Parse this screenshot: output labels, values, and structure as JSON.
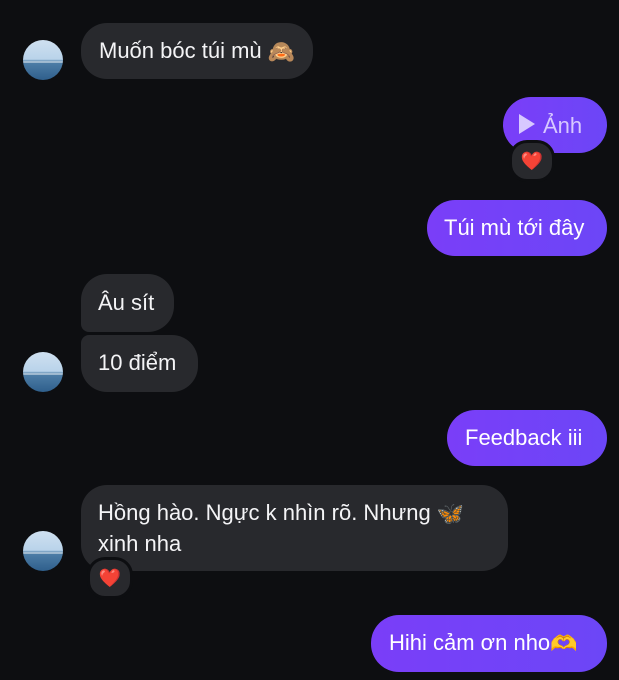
{
  "messages": {
    "m1": {
      "text": "Muốn bóc túi mù",
      "emoji": "🙈"
    },
    "m2": {
      "label": "Ảnh",
      "icon": "play-icon",
      "reaction": "❤️"
    },
    "m3": {
      "text": "Túi mù tới đây"
    },
    "m4": {
      "text": "Âu sít"
    },
    "m5": {
      "text": "10 điểm"
    },
    "m6": {
      "text": "Feedback iii"
    },
    "m7": {
      "line1": "Hồng hào. Ngực k nhìn rõ. Nhưng",
      "emoji": "🦋",
      "line2": "xinh nha",
      "reaction": "❤️"
    },
    "m8": {
      "text": "Hihi cảm ơn nho",
      "emoji": "🫶"
    }
  },
  "colors": {
    "background": "#0d0e11",
    "incoming_bubble": "#28292d",
    "outgoing_bubble": "#6e41f5",
    "reaction_heart": "#e5272f"
  }
}
